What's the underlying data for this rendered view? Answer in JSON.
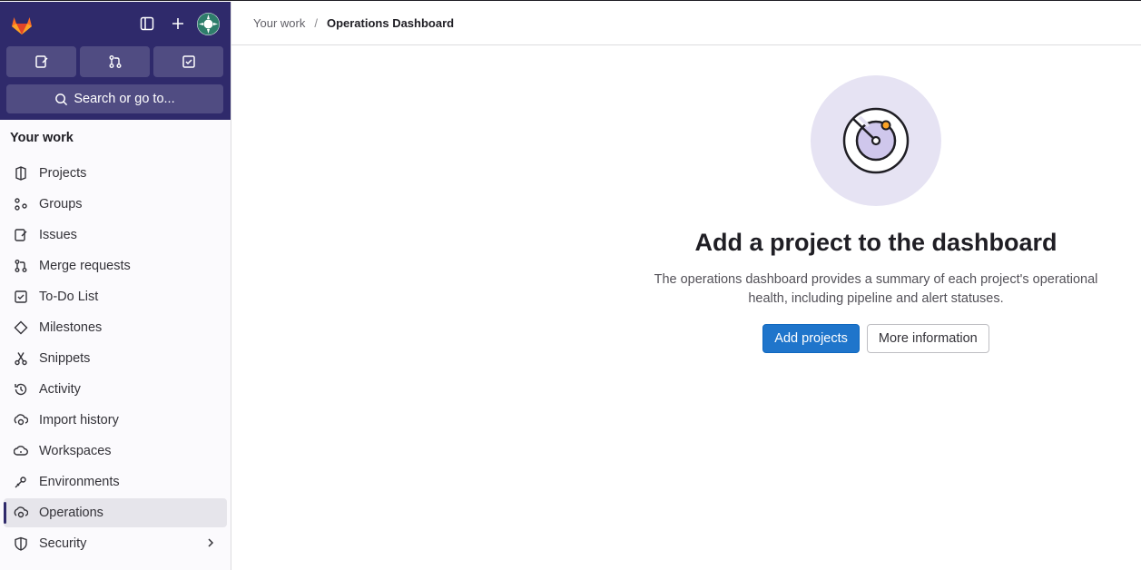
{
  "sidebar": {
    "search_label": "Search or go to...",
    "section_title": "Your work",
    "items": [
      {
        "label": "Projects",
        "icon": "project-icon"
      },
      {
        "label": "Groups",
        "icon": "group-icon"
      },
      {
        "label": "Issues",
        "icon": "issues-icon"
      },
      {
        "label": "Merge requests",
        "icon": "merge-request-icon"
      },
      {
        "label": "To-Do List",
        "icon": "todo-icon"
      },
      {
        "label": "Milestones",
        "icon": "milestone-icon"
      },
      {
        "label": "Snippets",
        "icon": "snippet-icon"
      },
      {
        "label": "Activity",
        "icon": "history-icon"
      },
      {
        "label": "Import history",
        "icon": "import-icon"
      },
      {
        "label": "Workspaces",
        "icon": "cloud-icon"
      },
      {
        "label": "Environments",
        "icon": "environment-icon"
      },
      {
        "label": "Operations",
        "icon": "operations-icon",
        "active": true
      },
      {
        "label": "Security",
        "icon": "shield-icon",
        "has_children": true
      }
    ]
  },
  "breadcrumb": {
    "parent": "Your work",
    "current": "Operations Dashboard"
  },
  "empty_state": {
    "title": "Add a project to the dashboard",
    "description": "The operations dashboard provides a summary of each project's operational health, including pipeline and alert statuses.",
    "primary_button": "Add projects",
    "secondary_button": "More information"
  },
  "colors": {
    "sidebar_header": "#2f2a6b",
    "primary": "#1f75cb",
    "illustration_bg": "#e6e3f3",
    "accent_dot": "#fca326"
  }
}
